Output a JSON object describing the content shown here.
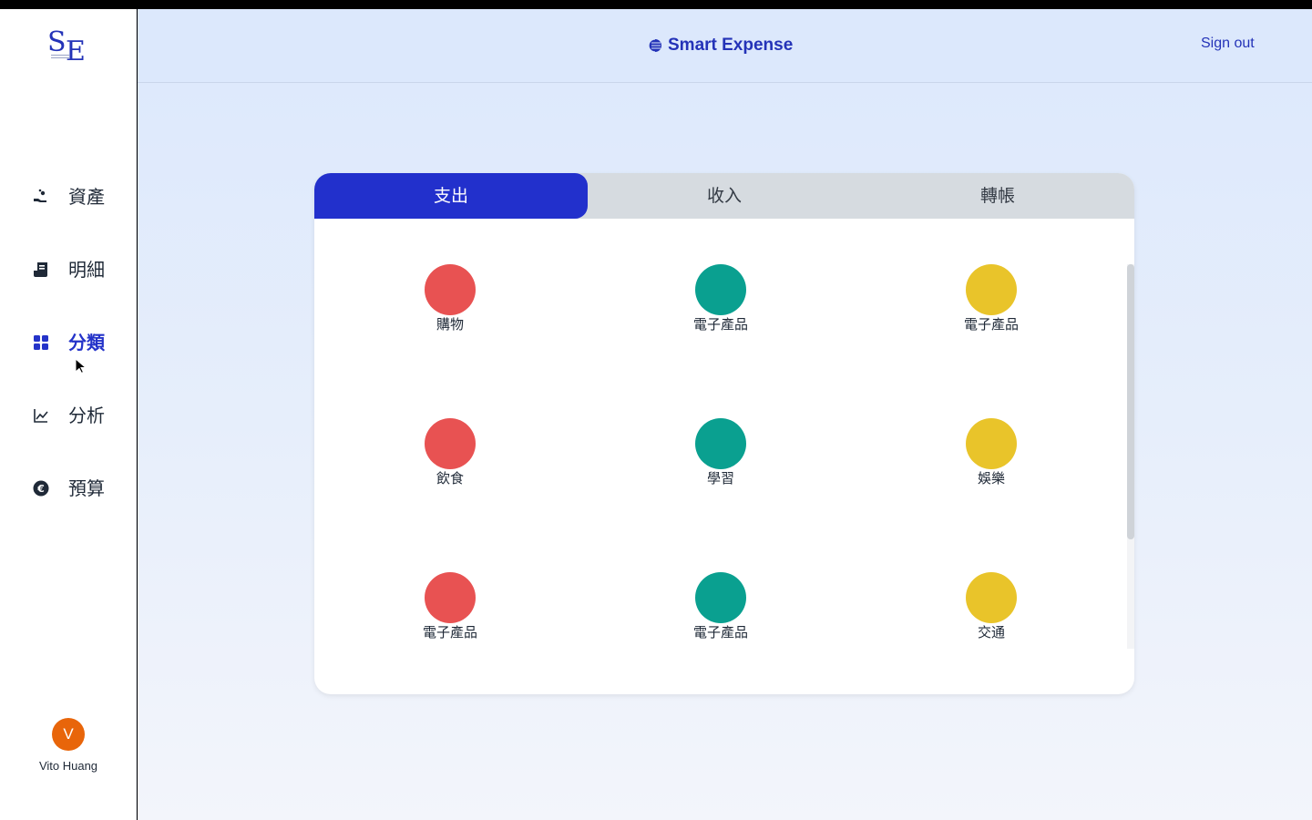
{
  "app": {
    "logo_s": "S",
    "logo_e": "E",
    "brand": "Smart Expense",
    "signout": "Sign out"
  },
  "sidebar": {
    "items": [
      {
        "label": "資產",
        "icon": "hand-coins-icon"
      },
      {
        "label": "明細",
        "icon": "receipt-icon"
      },
      {
        "label": "分類",
        "icon": "grid-icon"
      },
      {
        "label": "分析",
        "icon": "line-chart-icon"
      },
      {
        "label": "預算",
        "icon": "euro-coin-icon"
      }
    ],
    "active_index": 2
  },
  "user": {
    "initial": "V",
    "name": "Vito Huang"
  },
  "tabs": [
    "支出",
    "收入",
    "轉帳"
  ],
  "categories": [
    {
      "name": "購物",
      "color": "#e85252"
    },
    {
      "name": "電子產品",
      "color": "#0aa090"
    },
    {
      "name": "電子產品",
      "color": "#e9c42a"
    },
    {
      "name": "飲食",
      "color": "#e85252"
    },
    {
      "name": "學習",
      "color": "#0aa090"
    },
    {
      "name": "娛樂",
      "color": "#e9c42a"
    },
    {
      "name": "電子產品",
      "color": "#e85252"
    },
    {
      "name": "電子產品",
      "color": "#0aa090"
    },
    {
      "name": "交通",
      "color": "#e9c42a"
    }
  ],
  "colors": {
    "accent": "#2230cc",
    "avatar": "#e8650a"
  }
}
